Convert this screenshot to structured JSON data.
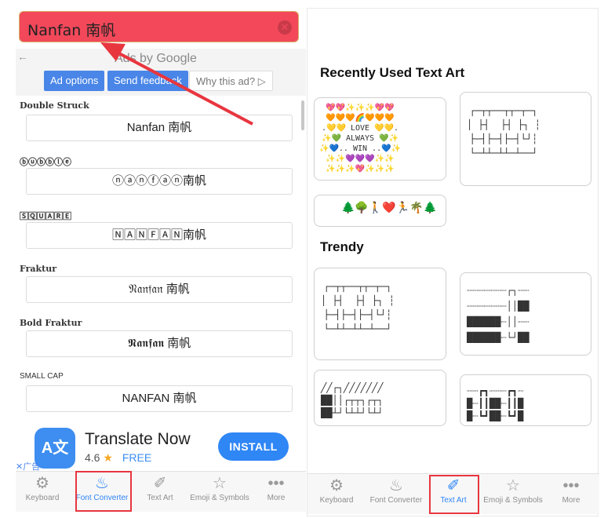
{
  "left": {
    "search": {
      "text": "Nanfan 南帆",
      "clear_glyph": "✕"
    },
    "ad": {
      "back_glyph": "←",
      "title": "Ads by Google",
      "options": "Ad options",
      "feedback": "Send feedback",
      "why": "Why this ad? ▷"
    },
    "fonts": [
      {
        "label": "Double Struck",
        "value": "Nanfan 南帆"
      },
      {
        "label": "ⓑⓤⓑⓑⓛⓔ",
        "value": "ⓝⓐⓝⓕⓐⓝ南帆"
      },
      {
        "label": "🅂🅀🅄🄰🅁🄴",
        "value": "🄽🄰🄽🄵🄰🄽南帆"
      },
      {
        "label": "Fraktur",
        "value": "𝔑𝔞𝔫𝔣𝔞𝔫 南帆"
      },
      {
        "label": "Bold Fraktur",
        "value": "𝕹𝖆𝖓𝖋𝖆𝖓 南帆"
      },
      {
        "label": "SMALL CAP",
        "value": "NANFAN 南帆"
      }
    ],
    "app_ad": {
      "icon_text": "A文",
      "name": "Translate Now",
      "rating": "4.6",
      "star": "★",
      "price": "FREE",
      "install": "INSTALL",
      "ad_mark": "✕广告"
    },
    "tabs": [
      {
        "label": "Keyboard",
        "icon": "gear-icon",
        "glyph": "⚙"
      },
      {
        "label": "Font Converter",
        "icon": "steam-icon",
        "glyph": "♨"
      },
      {
        "label": "Text Art",
        "icon": "brush-icon",
        "glyph": "✐"
      },
      {
        "label": "Emoji & Symbols",
        "icon": "star-icon",
        "glyph": "☆"
      },
      {
        "label": "More",
        "icon": "more-icon",
        "glyph": "•••"
      }
    ]
  },
  "right": {
    "recent_title": "Recently Used Text Art",
    "trendy_title": "Trendy",
    "cards": [
      {
        "art": "💖💖✨✨✨💖💖\n🧡🧡🧡🌈🧡🧡🧡\n.💛💛 LOVE 💛💛.\n✨💚 ALWAYS 💚✨\n✨💙.. WIN ..💙✨\n✨✨💜💜💜✨✨\n✨✨✨💖✨✨✨"
      },
      {
        "art": "┌─┬┬──┬┬─┬─┐\n│ ├┤  ├┤ ├┐ ┆\n├─┤├─┤├─┤└┘┆\n└─┴┴─┴┴─┴──┘"
      },
      {
        "art": "🌲🌳🚶❤️🏃🌴🌲"
      },
      {
        "art": "┌─┬┬──┬┬─┬─┐\n│ ├┤  ├┤ ├┐ ┆\n├─┤├─┤├─┤└┘┆\n└─┴┴─┴┴─┴──┘"
      },
      {
        "art": "┈┈┈┈┈┈┈┌┐┈┈\n┈┈┈┈┈┈┈││██\n██████┈││┈┈\n██████┈└┘██"
      },
      {
        "art": "╱╱┌┐╱╱╱╱╱╱╱\n██││┌┬┬┐┌┬┐\n██┴┘└┴┴┘└┴┘"
      },
      {
        "art": "┈┈┏┓┈┈┈┏┓┈\n█┈┃┃██┈┃┃█\n█┈┗┛██┈┗┛█"
      }
    ],
    "tabs": [
      {
        "label": "Keyboard",
        "icon": "gear-icon",
        "glyph": "⚙"
      },
      {
        "label": "Font Converter",
        "icon": "steam-icon",
        "glyph": "♨"
      },
      {
        "label": "Text Art",
        "icon": "brush-icon",
        "glyph": "✐"
      },
      {
        "label": "Emoji & Symbols",
        "icon": "star-icon",
        "glyph": "☆"
      },
      {
        "label": "More",
        "icon": "more-icon",
        "glyph": "•••"
      }
    ]
  },
  "colors": {
    "search_bg": "#f2485a",
    "accent": "#2f86f5",
    "highlight": "#e8363f"
  }
}
